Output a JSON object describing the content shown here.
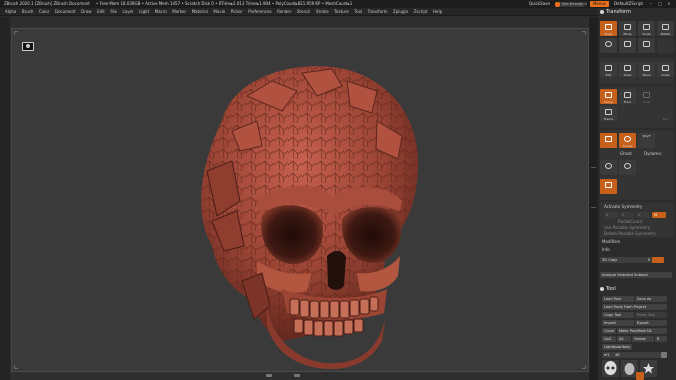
{
  "titlebar": {
    "app": "ZBrush 2020.1 [ZBrush]   ZBrush Document",
    "stats": "• Free Mem 18.039GB • Active Mem 1457 • Scratch Disk 0 • RTime▸2.013 Timer▸1.904 • PolyCount▸821.959 KP • MeshCount▸1",
    "quicksave": "QuickSave",
    "see_through": "See-through  0",
    "menus": "Menus",
    "default_script": "DefaultZScript"
  },
  "menubar": [
    "Alpha",
    "Brush",
    "Color",
    "Document",
    "Draw",
    "Edit",
    "File",
    "Layer",
    "Light",
    "Macro",
    "Marker",
    "Material",
    "Movie",
    "Picker",
    "Preferences",
    "Render",
    "Stencil",
    "Stroke",
    "Texture",
    "Tool",
    "Transform",
    "Zplugin",
    "Zscript",
    "Help"
  ],
  "right_panel": {
    "transform_title": "Transform",
    "transform_row1": [
      "Move",
      "Scale",
      "Rotate"
    ],
    "row2": [
      "Edit",
      "Draw",
      "Move",
      "Scale"
    ],
    "edit_row": [
      "Edit",
      "Draw",
      "Move",
      "Scale",
      "Rotate"
    ],
    "persp_row": [
      "Persp",
      "Floor",
      "Local",
      "Frame",
      "Xyz"
    ],
    "solo_row": [
      "Solo",
      "Transp",
      "Ghost",
      "Dynamic"
    ],
    "polyf": "PolyF",
    "local_sym": "Local Symmetry",
    "activate_symmetry": "Activate Symmetry",
    "sym_axes": [
      "X",
      "Y",
      "Z",
      "M"
    ],
    "radial_count": "RadialCount",
    "use_posable": "Use Posable Symmetry",
    "delete_posable": "Delete Posable Symmetry",
    "modifiers": "Modifiers",
    "info": "Info",
    "copy_label": "3D Copy",
    "copy_value": "5",
    "analyze": "Analyze Selected Subtool",
    "tool_title": "Tool",
    "tool_buttons": [
      [
        "Load Tool",
        "Save As"
      ],
      [
        "Load Tools From Project",
        ""
      ],
      [
        "Copy Tool",
        "Paste Tool"
      ],
      [
        "Import",
        "Export"
      ],
      [
        "Clone",
        "Make PolyMesh3D"
      ],
      [
        "GoZ",
        "All",
        "Visible",
        "R"
      ],
      [
        "Lightbox▸Tools",
        ""
      ]
    ],
    "tool_slider_label": "ef1",
    "tool_slider_value": "48",
    "thumbs": [
      "Skull",
      "Skull",
      "Sphere3D",
      "PolyMesh"
    ]
  },
  "colors": {
    "accent": "#e8701a",
    "clay": "#a0473a",
    "canvas": "#3a3a3a"
  },
  "canvas": {
    "camera_icon": "camera-icon"
  }
}
